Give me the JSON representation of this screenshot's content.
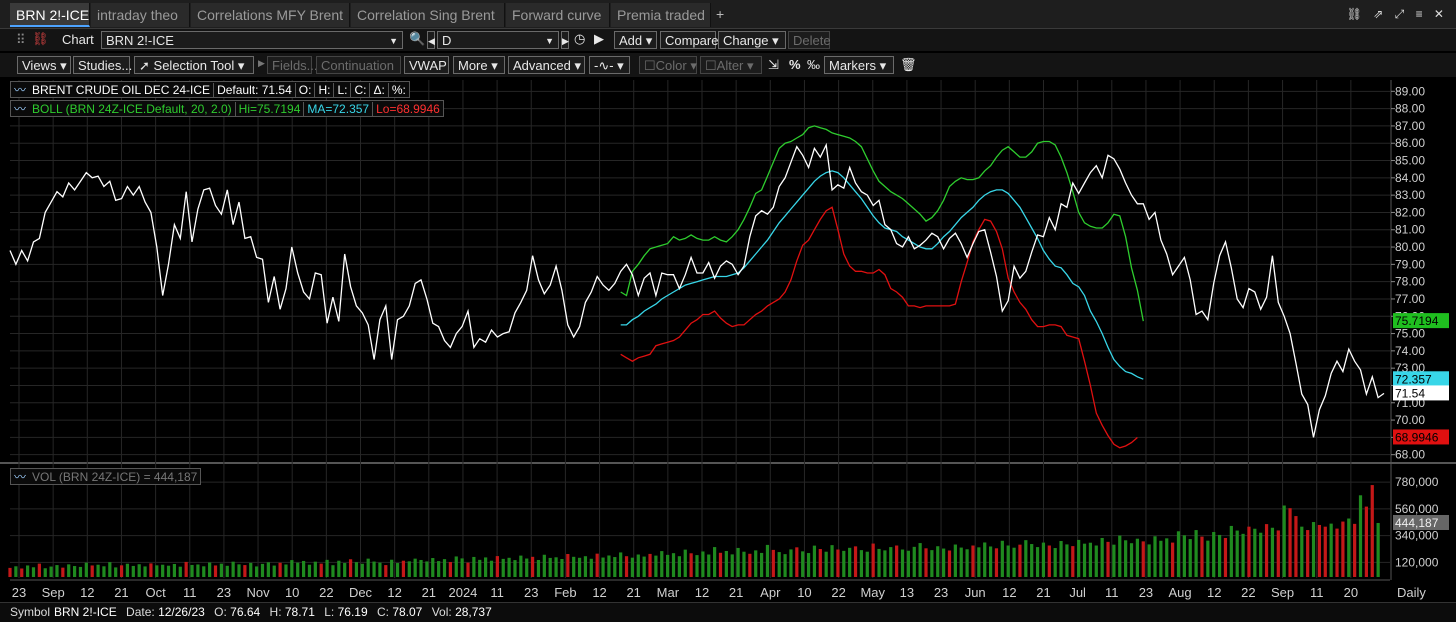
{
  "tabs": [
    {
      "label": "BRN 2!-ICE",
      "active": true
    },
    {
      "label": "intraday theo"
    },
    {
      "label": "Correlations MFY Brent"
    },
    {
      "label": "Correlation Sing Brent"
    },
    {
      "label": "Forward curve"
    },
    {
      "label": "Premia traded"
    }
  ],
  "toolbar": {
    "chart_label": "Chart",
    "symbol_value": "BRN 2!-ICE",
    "period_value": "D",
    "add": "Add",
    "compare": "Compare",
    "change": "Change",
    "delete": "Delete",
    "views": "Views",
    "studies": "Studies...",
    "selection_tool": "Selection Tool",
    "default": "Default",
    "fields": "Fields...",
    "continuation": "Continuation",
    "vwap": "VWAP",
    "more": "More",
    "advanced": "Advanced",
    "color": "Color",
    "alter": "Alter",
    "markers": "Markers"
  },
  "legend": {
    "price_name": "BRENT CRUDE OIL DEC 24-ICE",
    "price_default": "Default: 71.54",
    "o": "O:",
    "h": "H:",
    "l": "L:",
    "c": "C:",
    "delta": "Δ:",
    "pct": "%:",
    "boll_name": "BOLL (BRN 24Z-ICE.Default, 20, 2.0)",
    "boll_hi": "Hi=75.7194",
    "boll_ma": "MA=72.357",
    "boll_lo": "Lo=68.9946",
    "vol": "VOL (BRN 24Z-ICE) = 444,187"
  },
  "colors": {
    "price": "#ffffff",
    "upper": "#2ecc2e",
    "middle": "#38d6e8",
    "lower": "#e01010",
    "vol_up": "#1f8a1f",
    "vol_down": "#c41818"
  },
  "price_axis": {
    "ticks": [
      "89.00",
      "88.00",
      "87.00",
      "86.00",
      "85.00",
      "84.00",
      "83.00",
      "82.00",
      "81.00",
      "80.00",
      "79.00",
      "78.00",
      "77.00",
      "76.00",
      "75.00",
      "74.00",
      "73.00",
      "72.00",
      "71.00",
      "70.00",
      "69.00",
      "68.00"
    ],
    "range": [
      67.75,
      89.25
    ]
  },
  "price_tags": [
    {
      "label": "75.7194",
      "value": 75.7194,
      "bg": "#1fbf1f",
      "fg": "#000"
    },
    {
      "label": "72.357",
      "value": 72.357,
      "bg": "#38d6e8",
      "fg": "#000"
    },
    {
      "label": "71.54",
      "value": 71.54,
      "bg": "#ffffff",
      "fg": "#000"
    },
    {
      "label": "68.9946",
      "value": 68.9946,
      "bg": "#e01010",
      "fg": "#000"
    }
  ],
  "volume_axis": {
    "ticks": [
      "780,000",
      "560,000",
      "340,000",
      "120,000"
    ],
    "tick_values": [
      780000,
      560000,
      340000,
      120000
    ],
    "max": 880000,
    "current": "444,187",
    "current_value": 444187
  },
  "time_axis": {
    "labels": [
      "23",
      "Sep",
      "12",
      "21",
      "Oct",
      "11",
      "23",
      "Nov",
      "10",
      "22",
      "Dec",
      "12",
      "21",
      "2024",
      "11",
      "23",
      "Feb",
      "12",
      "21",
      "Mar",
      "12",
      "21",
      "Apr",
      "10",
      "22",
      "May",
      "13",
      "23",
      "Jun",
      "12",
      "21",
      "Jul",
      "11",
      "23",
      "Aug",
      "12",
      "22",
      "Sep",
      "11",
      "20"
    ],
    "interval": "Daily"
  },
  "chart_data": {
    "type": "line",
    "series": [
      {
        "name": "BRENT CRUDE OIL DEC 24-ICE",
        "values": [
          79.8,
          79.0,
          79.8,
          79.2,
          80.3,
          80.5,
          82.0,
          82.6,
          83.2,
          82.9,
          83.7,
          83.3,
          83.8,
          84.3,
          84.0,
          84.1,
          83.5,
          83.8,
          82.7,
          82.8,
          83.5,
          83.0,
          83.5,
          82.6,
          82.0,
          80.0,
          77.2,
          79.0,
          81.3,
          80.5,
          83.2,
          80.3,
          82.2,
          83.3,
          83.4,
          82.4,
          81.9,
          83.3,
          81.3,
          82.6,
          80.5,
          80.6,
          79.4,
          79.3,
          76.8,
          78.3,
          76.4,
          77.6,
          80.0,
          78.5,
          77.4,
          77.0,
          78.5,
          78.4,
          75.6,
          77.1,
          75.7,
          79.6,
          77.7,
          76.6,
          76.2,
          75.5,
          73.5,
          75.8,
          76.6,
          73.5,
          75.8,
          76.0,
          76.6,
          77.9,
          78.1,
          77.0,
          75.6,
          75.4,
          74.6,
          74.2,
          75.0,
          75.4,
          76.3,
          74.2,
          74.7,
          74.5,
          75.2,
          74.8,
          75.0,
          75.1,
          76.2,
          76.8,
          77.5,
          79.5,
          78.1,
          77.3,
          77.8,
          78.9,
          77.5,
          75.5,
          74.8,
          75.4,
          76.8,
          77.4,
          78.3,
          77.8,
          77.5,
          77.9,
          78.6,
          79.0,
          78.4,
          77.2,
          78.2,
          78.5,
          77.2,
          78.5,
          78.4,
          78.4,
          77.6,
          78.4,
          79.4,
          78.5,
          78.5,
          79.1,
          78.2,
          78.9,
          79.2,
          79.0,
          78.4,
          78.9,
          80.6,
          81.8,
          82.1,
          81.9,
          82.3,
          83.5,
          84.0,
          84.9,
          85.8,
          85.3,
          84.6,
          85.7,
          85.2,
          85.9,
          83.3,
          83.6,
          83.4,
          84.6,
          83.7,
          83.2,
          83.0,
          82.4,
          82.7,
          81.3,
          81.0,
          80.2,
          80.0,
          80.6,
          79.9,
          80.1,
          80.4,
          80.8,
          80.6,
          79.9,
          80.5,
          80.8,
          80.2,
          79.4,
          80.2,
          80.9,
          81.0,
          79.7,
          78.3,
          76.3,
          76.9,
          78.9,
          78.2,
          78.6,
          79.7,
          80.7,
          80.6,
          81.7,
          81.0,
          82.5,
          82.3,
          83.7,
          83.1,
          83.7,
          84.3,
          84.7,
          84.0,
          85.3,
          85.1,
          84.5,
          83.7,
          83.0,
          82.5,
          82.5,
          81.6,
          82.0,
          80.4,
          79.6,
          78.4,
          78.9,
          79.4,
          78.1,
          76.1,
          76.3,
          75.8,
          77.9,
          79.5,
          80.3,
          78.8,
          77.0,
          76.5,
          77.6,
          77.4,
          76.4,
          77.1,
          79.5,
          76.8,
          76.0,
          75.0,
          73.3,
          71.5,
          70.9,
          69.0,
          70.6,
          71.4,
          72.7,
          73.4,
          72.8,
          74.1,
          73.4,
          72.9,
          71.5,
          72.5,
          71.3,
          71.54
        ]
      },
      {
        "name": "Hi",
        "start_index": 104,
        "values": [
          77.4,
          77.2,
          78.6,
          79.0,
          79.5,
          79.9,
          80.0,
          80.1,
          80.2,
          80.6,
          80.4,
          80.5,
          80.7,
          80.5,
          80.4,
          80.4,
          80.6,
          80.4,
          80.3,
          80.6,
          81.0,
          81.6,
          82.3,
          83.1,
          83.3,
          84.1,
          84.9,
          85.7,
          86.0,
          86.1,
          86.3,
          86.5,
          86.9,
          87.0,
          86.9,
          86.8,
          86.6,
          86.5,
          86.4,
          86.3,
          86.1,
          85.8,
          85.1,
          84.4,
          83.8,
          83.5,
          83.2,
          83.0,
          82.8,
          82.5,
          82.2,
          81.9,
          81.5,
          81.7,
          82.1,
          82.7,
          83.5,
          83.8,
          84.0,
          83.9,
          83.9,
          84.0,
          84.4,
          84.7,
          85.2,
          85.6,
          85.8,
          85.5,
          85.2,
          85.2,
          85.5,
          86.0,
          86.1,
          86.1,
          85.9,
          85.2,
          84.3,
          83.2,
          82.0,
          81.4,
          81.2,
          81.1,
          81.1,
          81.4,
          81.9,
          81.8,
          80.6,
          78.8,
          77.5,
          75.72
        ]
      },
      {
        "name": "MA",
        "start_index": 104,
        "values": [
          75.5,
          75.5,
          75.8,
          76.0,
          76.3,
          76.5,
          76.7,
          77.0,
          77.2,
          77.4,
          77.6,
          77.8,
          77.9,
          78.0,
          78.1,
          78.2,
          78.3,
          78.3,
          78.3,
          78.4,
          78.5,
          78.8,
          79.2,
          79.6,
          80.0,
          80.4,
          80.9,
          81.4,
          81.8,
          82.2,
          82.6,
          83.0,
          83.4,
          83.8,
          84.1,
          84.3,
          84.4,
          84.3,
          84.0,
          83.6,
          83.2,
          82.8,
          82.3,
          81.8,
          81.4,
          81.1,
          81.0,
          80.9,
          80.6,
          80.4,
          80.2,
          80.0,
          79.9,
          79.9,
          80.2,
          80.6,
          80.9,
          81.3,
          81.7,
          82.0,
          82.3,
          82.7,
          83.0,
          83.2,
          83.3,
          83.3,
          83.1,
          82.7,
          82.3,
          81.7,
          81.1,
          80.5,
          79.8,
          79.3,
          78.9,
          78.8,
          78.4,
          77.9,
          77.7,
          77.2,
          76.3,
          75.7,
          75.0,
          74.2,
          73.5,
          73.1,
          72.8,
          72.7,
          72.5,
          72.36
        ]
      },
      {
        "name": "Lo",
        "start_index": 104,
        "values": [
          73.8,
          73.6,
          73.4,
          73.6,
          73.7,
          73.8,
          74.3,
          74.4,
          74.5,
          74.6,
          74.8,
          75.2,
          75.6,
          75.8,
          76.1,
          76.1,
          76.3,
          75.9,
          75.6,
          75.4,
          75.5,
          75.5,
          75.8,
          76.1,
          76.3,
          76.6,
          76.8,
          77.0,
          77.4,
          78.1,
          79.2,
          80.1,
          80.4,
          81.0,
          81.6,
          82.1,
          82.3,
          81.0,
          79.6,
          78.9,
          78.6,
          78.6,
          78.5,
          78.5,
          78.7,
          78.4,
          77.6,
          77.4,
          77.1,
          76.6,
          76.6,
          76.5,
          76.6,
          76.6,
          76.6,
          76.6,
          76.6,
          76.7,
          78.0,
          79.1,
          80.3,
          81.0,
          81.6,
          81.5,
          80.9,
          79.9,
          78.2,
          77.4,
          76.8,
          76.4,
          75.8,
          75.4,
          75.4,
          75.5,
          75.5,
          75.4,
          74.9,
          74.8,
          74.7,
          73.4,
          72.0,
          70.4,
          69.7,
          69.1,
          68.6,
          68.4,
          68.5,
          68.7,
          68.99
        ]
      },
      {
        "name": "VOL",
        "values": [
          75000,
          88000,
          70000,
          95000,
          80000,
          110000,
          72000,
          86000,
          98000,
          77000,
          104000,
          90000,
          83000,
          118000,
          95000,
          101000,
          88000,
          122000,
          79000,
          96000,
          109000,
          91000,
          105000,
          87000,
          112000,
          96000,
          101000,
          93000,
          107000,
          85000,
          124000,
          99000,
          103000,
          88000,
          119000,
          95000,
          110000,
          92000,
          126000,
          104000,
          98000,
          116000,
          87000,
          108000,
          121000,
          94000,
          117000,
          103000,
          139000,
          118000,
          132000,
          101000,
          126000,
          110000,
          141000,
          97000,
          134000,
          115000,
          146000,
          122000,
          109000,
          151000,
          127000,
          118000,
          98000,
          142000,
          115000,
          134000,
          129000,
          151000,
          140000,
          128000,
          156000,
          131000,
          147000,
          123000,
          169000,
          153000,
          118000,
          165000,
          141000,
          161000,
          134000,
          172000,
          149000,
          158000,
          139000,
          176000,
          152000,
          166000,
          140000,
          183000,
          157000,
          162000,
          148000,
          189000,
          166000,
          158000,
          171000,
          150000,
          192000,
          160000,
          177000,
          164000,
          202000,
          171000,
          159000,
          185000,
          168000,
          190000,
          176000,
          213000,
          182000,
          196000,
          171000,
          225000,
          195000,
          180000,
          210000,
          185000,
          246000,
          199000,
          214000,
          186000,
          239000,
          208000,
          191000,
          219000,
          198000,
          264000,
          223000,
          205000,
          188000,
          227000,
          244000,
          211000,
          197000,
          258000,
          230000,
          208000,
          262000,
          226000,
          215000,
          240000,
          252000,
          221000,
          208000,
          275000,
          231000,
          219000,
          246000,
          259000,
          226000,
          216000,
          248000,
          279000,
          236000,
          221000,
          253000,
          234000,
          218000,
          267000,
          242000,
          228000,
          259000,
          244000,
          284000,
          251000,
          236000,
          298000,
          259000,
          241000,
          266000,
          303000,
          271000,
          246000,
          283000,
          259000,
          238000,
          296000,
          268000,
          254000,
          305000,
          274000,
          282000,
          259000,
          321000,
          289000,
          266000,
          341000,
          302000,
          278000,
          315000,
          293000,
          268000,
          335000,
          298000,
          318000,
          283000,
          376000,
          343000,
          312000,
          386000,
          332000,
          299000,
          370000,
          346000,
          321000,
          420000,
          382000,
          355000,
          414000,
          397000,
          364000,
          435000,
          405000,
          383000,
          588000,
          566000,
          501000,
          414000,
          386000,
          452000,
          428000,
          414000,
          439000,
          398000,
          456000,
          481000,
          437000,
          672000,
          579000,
          756000,
          444187
        ]
      }
    ],
    "vol_down_indices": [
      0,
      2,
      5,
      9,
      14,
      19,
      24,
      30,
      35,
      40,
      46,
      53,
      58,
      64,
      67,
      75,
      78,
      83,
      89,
      95,
      100,
      105,
      109,
      116,
      121,
      126,
      130,
      134,
      138,
      141,
      144,
      147,
      151,
      156,
      160,
      164,
      168,
      172,
      177,
      181,
      187,
      193,
      198,
      203,
      207,
      211,
      214,
      216,
      218,
      219,
      221,
      223,
      224,
      226,
      227,
      229,
      231,
      232,
      235,
      236,
      237,
      240,
      242
    ]
  }
}
